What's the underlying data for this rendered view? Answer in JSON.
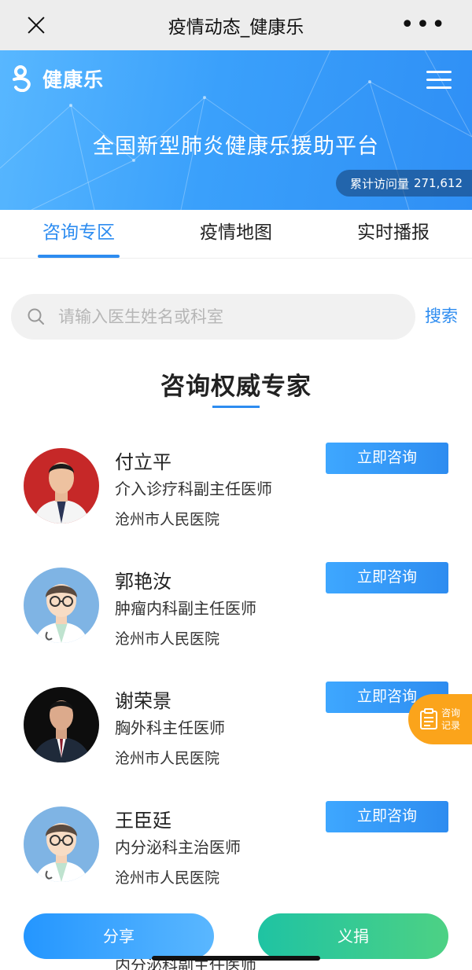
{
  "wechat_bar": {
    "title": "疫情动态_健康乐"
  },
  "banner": {
    "brand": "健康乐",
    "headline": "全国新型肺炎健康乐援助平台",
    "visits_label": "累计访问量",
    "visits_count": "271,612"
  },
  "tabs": [
    {
      "label": "咨询专区",
      "active": true
    },
    {
      "label": "疫情地图",
      "active": false
    },
    {
      "label": "实时播报",
      "active": false
    }
  ],
  "search": {
    "placeholder": "请输入医生姓名或科室",
    "button_label": "搜索"
  },
  "section": {
    "title": "咨询权威专家"
  },
  "doctors": [
    {
      "name": "付立平",
      "title": "介入诊疗科副主任医师",
      "hospital": "沧州市人民医院",
      "avatar": "photo-red-background",
      "consult_label": "立即咨询"
    },
    {
      "name": "郭艳汝",
      "title": "肿瘤内科副主任医师",
      "hospital": "沧州市人民医院",
      "avatar": "cartoon-doctor",
      "consult_label": "立即咨询"
    },
    {
      "name": "谢荣景",
      "title": "胸外科主任医师",
      "hospital": "沧州市人民医院",
      "avatar": "photo-dark-background",
      "consult_label": "立即咨询"
    },
    {
      "name": "王臣廷",
      "title": "内分泌科主治医师",
      "hospital": "沧州市人民医院",
      "avatar": "cartoon-doctor",
      "consult_label": "立即咨询"
    }
  ],
  "partial_row_text": "内分泌科副主任医师",
  "record_bubble": {
    "line1": "咨询",
    "line2": "记录"
  },
  "bottom": {
    "share_label": "分享",
    "donate_label": "义捐"
  },
  "colors": {
    "accent": "#2d8cf0",
    "record": "#fba41b",
    "donate": "#1fc3a3"
  }
}
